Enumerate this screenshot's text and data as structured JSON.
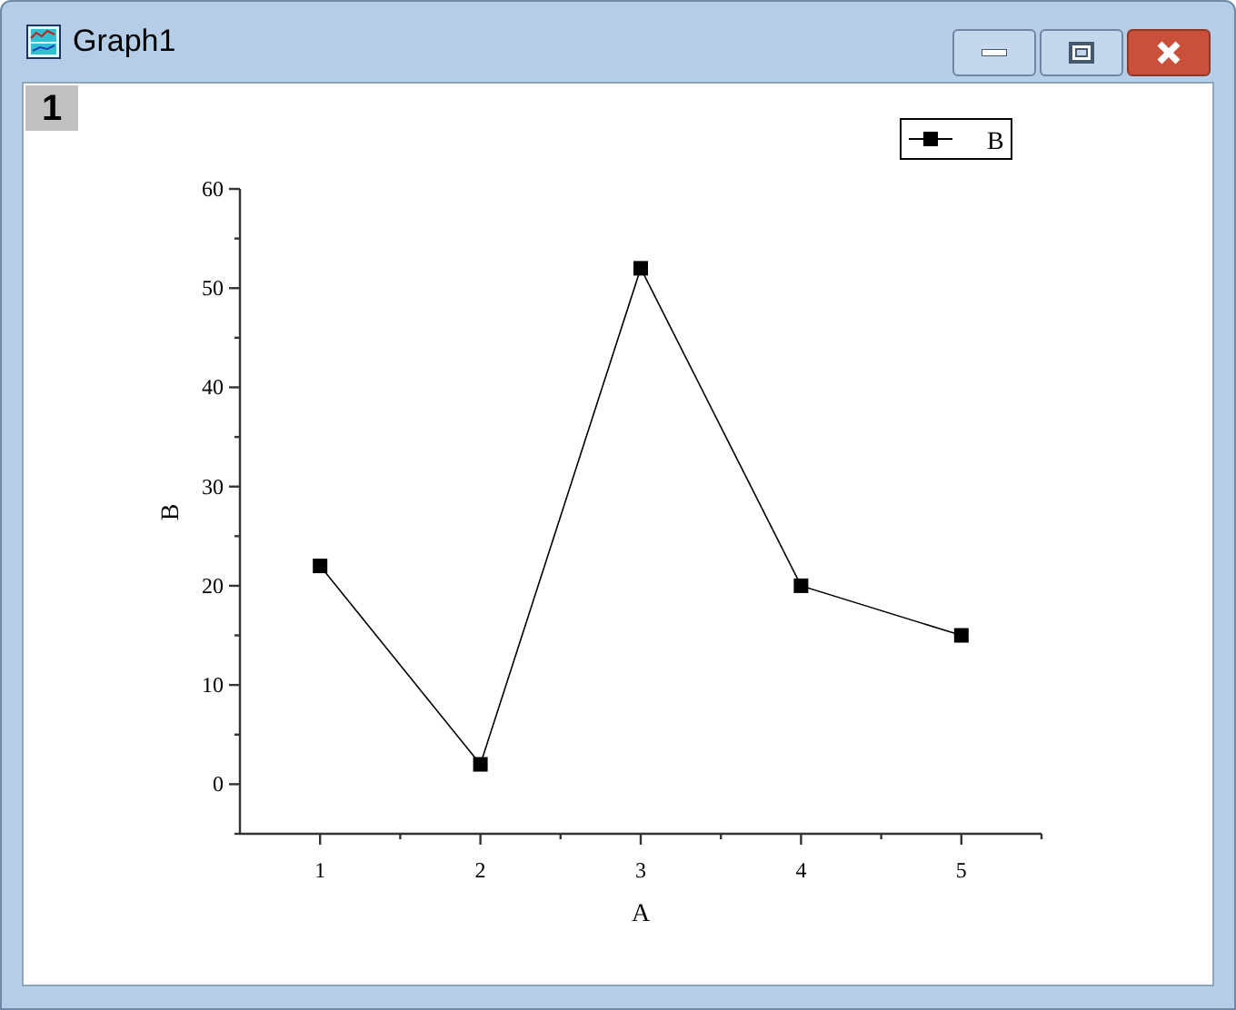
{
  "window": {
    "title": "Graph1"
  },
  "layer_label": "1",
  "graph": {
    "chart_data": {
      "type": "line",
      "xlabel": "A",
      "ylabel": "B",
      "x": [
        1,
        2,
        3,
        4,
        5
      ],
      "series": [
        {
          "name": "B",
          "color": "#000000",
          "marker": "square",
          "values": [
            22,
            2,
            52,
            20,
            15
          ]
        }
      ],
      "xlim": [
        0.5,
        5.5
      ],
      "ylim": [
        -5,
        60
      ],
      "xticks": [
        1,
        2,
        3,
        4,
        5
      ],
      "yticks": [
        0,
        10,
        20,
        30,
        40,
        50,
        60
      ]
    }
  }
}
